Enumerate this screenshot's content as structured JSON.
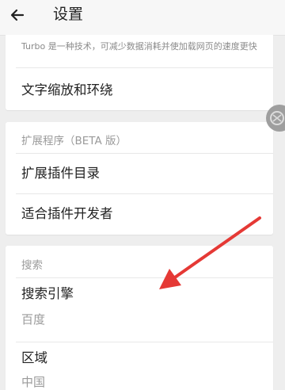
{
  "appbar": {
    "title": "设置",
    "back_icon": "arrow-left-icon"
  },
  "turbo": {
    "description": "Turbo 是一种技术，可减少数据消耗并使加载网页的速度更快"
  },
  "text_scaling": {
    "label": "文字缩放和环绕"
  },
  "extensions": {
    "header": "扩展程序（BETA 版）",
    "items": [
      {
        "label": "扩展插件目录"
      },
      {
        "label": "适合插件开发者"
      }
    ]
  },
  "search": {
    "header": "搜索",
    "engine_label": "搜索引擎",
    "engine_value": "百度",
    "region_label": "区域",
    "region_value": "中国"
  },
  "annotation": {
    "arrow_color": "#e53935"
  },
  "colors": {
    "background": "#eeeeee",
    "card": "#ffffff",
    "primary_text": "#222222",
    "secondary_text": "#9a9a9a"
  }
}
